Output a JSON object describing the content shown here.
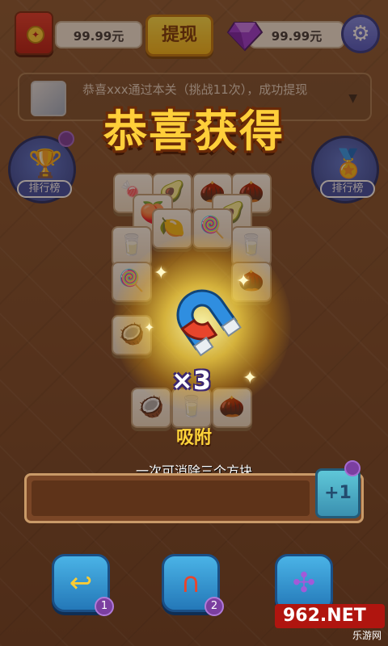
{
  "topbar": {
    "cash_amount": "99.99元",
    "withdraw_label": "提现",
    "gem_amount": "99.99元",
    "settings_icon": "gear-icon"
  },
  "notice": {
    "text": "恭喜xxx通过本关（挑战11次），成功提现"
  },
  "side_badges": {
    "left_label": "排行榜",
    "right_label": "排行榜"
  },
  "reward": {
    "title": "恭喜获得",
    "item_icon": "magnet-icon",
    "quantity": "×3",
    "item_name": "吸附",
    "item_description": "一次可消除三个方块"
  },
  "slotbar": {
    "plus_label": "+1"
  },
  "tools": [
    {
      "icon": "undo-arrow-icon",
      "count": "1"
    },
    {
      "icon": "magnet-icon",
      "count": "2"
    },
    {
      "icon": "pinwheel-icon",
      "count": ""
    }
  ],
  "watermark": {
    "logo": "962.NET",
    "sub": "乐游网"
  },
  "colors": {
    "accent_yellow": "#ffcf3a",
    "magnet_blue": "#2f8ee0",
    "magnet_red": "#e8452c",
    "tool_blue": "#2478b8"
  }
}
